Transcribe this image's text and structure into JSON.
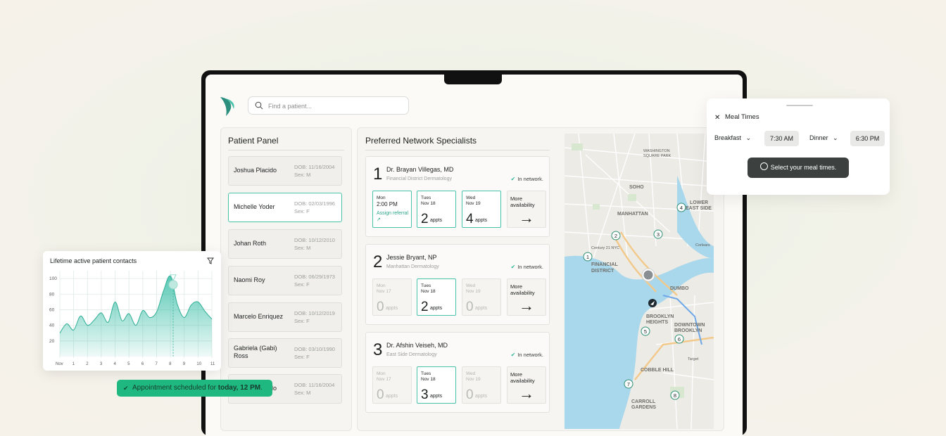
{
  "search": {
    "placeholder": "Find a patient..."
  },
  "patient_panel": {
    "title": "Patient Panel",
    "patients": [
      {
        "name": "Joshua Placido",
        "dob": "DOB: 11/16/2004",
        "sex": "Sex: M",
        "selected": false
      },
      {
        "name": "Michelle Yoder",
        "dob": "DOB: 02/03/1996",
        "sex": "Sex: F",
        "selected": true
      },
      {
        "name": "Johan Roth",
        "dob": "DOB: 10/12/2010",
        "sex": "Sex: M",
        "selected": false
      },
      {
        "name": "Naomi Roy",
        "dob": "DOB: 06/29/1973",
        "sex": "Sex: F",
        "selected": false
      },
      {
        "name": "Marcelo Enriquez",
        "dob": "DOB: 10/12/2019",
        "sex": "Sex: F",
        "selected": false
      },
      {
        "name": "Gabriela (Gabi) Ross",
        "dob": "DOB: 03/10/1990",
        "sex": "Sex: F",
        "selected": false
      },
      {
        "name": "Joshua Placido",
        "dob": "DOB: 11/16/2004",
        "sex": "Sex: M",
        "selected": false
      }
    ]
  },
  "specialists": {
    "title": "Preferred Network Specialists",
    "in_network_label": "In network.",
    "more_label": "More availability",
    "appts_label": "appts",
    "items": [
      {
        "rank": "1",
        "name": "Dr. Brayan Villegas, MD",
        "location": "Financial District Dermatology",
        "slots": [
          {
            "day": "Mon",
            "date": "",
            "time": "2:00 PM",
            "action": "Assign referral"
          },
          {
            "day": "Tues",
            "date": "Nov 18",
            "count": "2"
          },
          {
            "day": "Wed",
            "date": "Nov 19",
            "count": "4"
          }
        ]
      },
      {
        "rank": "2",
        "name": "Jessie Bryant, NP",
        "location": "Manhattan Dermatology",
        "slots": [
          {
            "day": "Mon",
            "date": "Nov 17",
            "count": "0"
          },
          {
            "day": "Tues",
            "date": "Nov 18",
            "count": "2"
          },
          {
            "day": "Wed",
            "date": "Nov 19",
            "count": "0"
          }
        ]
      },
      {
        "rank": "3",
        "name": "Dr. Afshin Veiseh, MD",
        "location": "East Side Dermatology",
        "slots": [
          {
            "day": "Mon",
            "date": "Nov 17",
            "count": "0"
          },
          {
            "day": "Tues",
            "date": "Nov 18",
            "count": "3"
          },
          {
            "day": "Wed",
            "date": "Nov 19",
            "count": "0"
          }
        ]
      }
    ]
  },
  "map": {
    "labels": [
      "MANHATTAN",
      "SOHO",
      "FINANCIAL DISTRICT",
      "DUMBO",
      "BROOKLYN HEIGHTS",
      "DOWNTOWN BROOKLYN",
      "COBBLE HILL",
      "CARROLL GARDENS",
      "LOWER EAST SIDE"
    ],
    "markers": [
      "1",
      "2",
      "3",
      "4",
      "5",
      "6",
      "7",
      "8"
    ]
  },
  "meal_times": {
    "title": "Meal Times",
    "breakfast_label": "Breakfast",
    "breakfast_time": "7:30 AM",
    "dinner_label": "Dinner",
    "dinner_time": "6:30 PM",
    "button_label": "Select your meal times."
  },
  "chart_data": {
    "type": "area",
    "title": "Lifetime active patient contacts",
    "x_ticks": [
      "Nov",
      "1",
      "2",
      "3",
      "4",
      "5",
      "6",
      "7",
      "8",
      "9",
      "10",
      "11"
    ],
    "y_ticks": [
      "100",
      "80",
      "60",
      "40",
      "20"
    ],
    "ylim": [
      0,
      110
    ],
    "x": [
      0,
      0.5,
      1,
      1.5,
      2,
      2.5,
      3,
      3.5,
      4,
      4.5,
      5,
      5.5,
      6,
      6.5,
      7,
      7.5,
      8,
      8.5,
      9,
      9.5,
      10,
      10.5,
      11
    ],
    "values": [
      30,
      42,
      34,
      52,
      40,
      47,
      56,
      44,
      70,
      46,
      55,
      40,
      59,
      50,
      57,
      84,
      103,
      67,
      50,
      66,
      70,
      58,
      48
    ],
    "highlight": {
      "x": 8.2,
      "value": 85
    },
    "color": "#3cbfa8"
  },
  "toast": {
    "prefix": "Appointment scheduled for ",
    "bold": "today, 12 PM",
    "suffix": "."
  }
}
